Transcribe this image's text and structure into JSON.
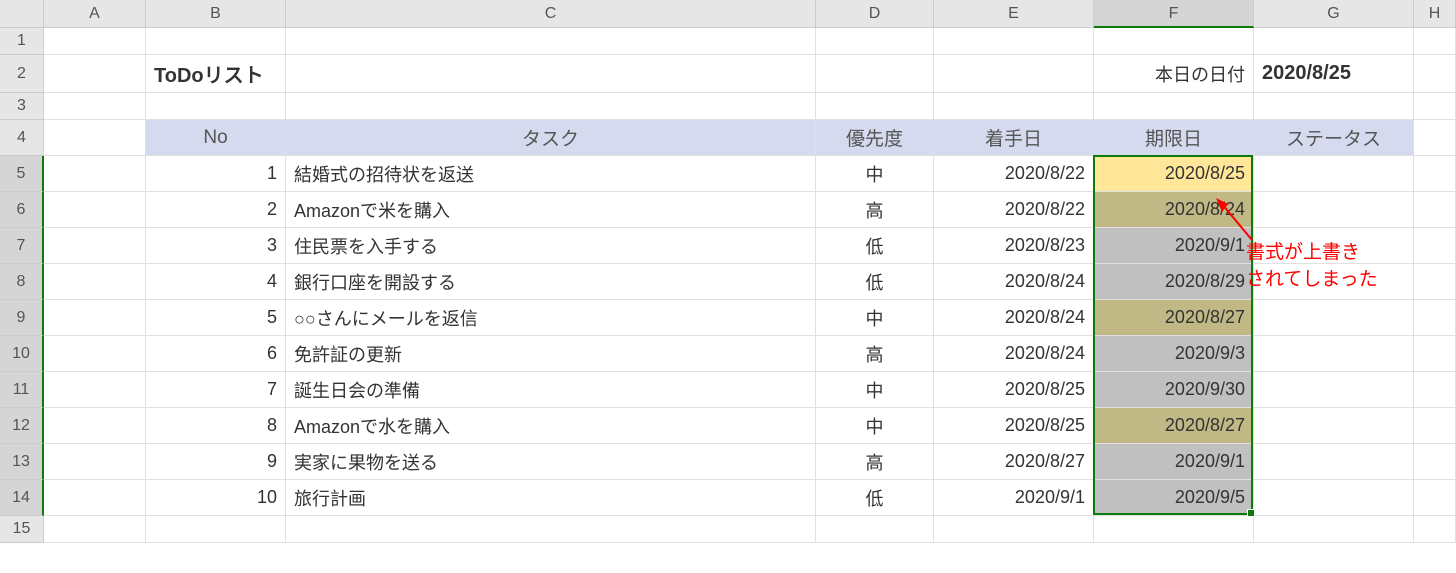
{
  "columns": [
    "A",
    "B",
    "C",
    "D",
    "E",
    "F",
    "G",
    "H"
  ],
  "activeColumn": "F",
  "rowCount": 15,
  "activeRows": [
    5,
    6,
    7,
    8,
    9,
    10,
    11,
    12,
    13,
    14
  ],
  "title_cell": "ToDoリスト",
  "today_label": "本日の日付",
  "today_value": "2020/8/25",
  "headers": {
    "no": "No",
    "task": "タスク",
    "priority": "優先度",
    "start": "着手日",
    "due": "期限日",
    "status": "ステータス"
  },
  "rows": [
    {
      "no": "1",
      "task": "結婚式の招待状を返送",
      "priority": "中",
      "start": "2020/8/22",
      "due": "2020/8/25",
      "due_cf": "cf-yellow"
    },
    {
      "no": "2",
      "task": "Amazonで米を購入",
      "priority": "高",
      "start": "2020/8/22",
      "due": "2020/8/24",
      "due_cf": "cf-olive"
    },
    {
      "no": "3",
      "task": "住民票を入手する",
      "priority": "低",
      "start": "2020/8/23",
      "due": "2020/9/1",
      "due_cf": "cf-gray"
    },
    {
      "no": "4",
      "task": "銀行口座を開設する",
      "priority": "低",
      "start": "2020/8/24",
      "due": "2020/8/29",
      "due_cf": "cf-gray"
    },
    {
      "no": "5",
      "task": "○○さんにメールを返信",
      "priority": "中",
      "start": "2020/8/24",
      "due": "2020/8/27",
      "due_cf": "cf-olive"
    },
    {
      "no": "6",
      "task": "免許証の更新",
      "priority": "高",
      "start": "2020/8/24",
      "due": "2020/9/3",
      "due_cf": "cf-gray"
    },
    {
      "no": "7",
      "task": "誕生日会の準備",
      "priority": "中",
      "start": "2020/8/25",
      "due": "2020/9/30",
      "due_cf": "cf-gray"
    },
    {
      "no": "8",
      "task": "Amazonで水を購入",
      "priority": "中",
      "start": "2020/8/25",
      "due": "2020/8/27",
      "due_cf": "cf-olive"
    },
    {
      "no": "9",
      "task": "実家に果物を送る",
      "priority": "高",
      "start": "2020/8/27",
      "due": "2020/9/1",
      "due_cf": "cf-gray"
    },
    {
      "no": "10",
      "task": "旅行計画",
      "priority": "低",
      "start": "2020/9/1",
      "due": "2020/9/5",
      "due_cf": "cf-gray"
    }
  ],
  "annotation": {
    "line1": "書式が上書き",
    "line2": "されてしまった"
  }
}
